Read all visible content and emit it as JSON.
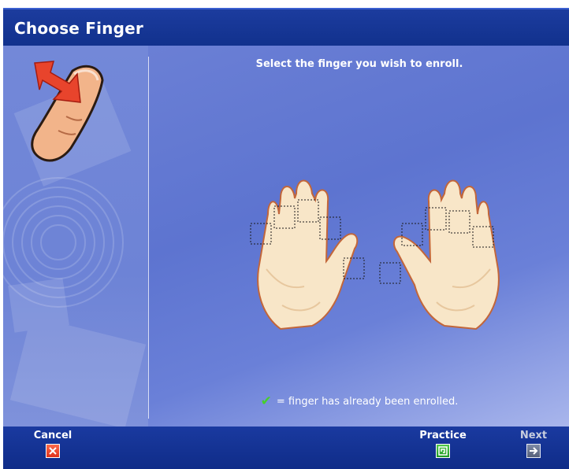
{
  "dialog": {
    "title": "Choose Finger"
  },
  "main": {
    "instruction": "Select the finger you wish to enroll.",
    "legend": {
      "icon": "checkmark-icon",
      "text": "= finger has already been enrolled."
    },
    "hands": {
      "left": [
        "left-little",
        "left-ring",
        "left-middle",
        "left-index",
        "left-thumb"
      ],
      "right": [
        "right-thumb",
        "right-index",
        "right-middle",
        "right-ring",
        "right-little"
      ]
    }
  },
  "footer": {
    "cancel": {
      "label": "Cancel",
      "icon": "close-icon"
    },
    "practice": {
      "label": "Practice",
      "icon": "practice-icon"
    },
    "next": {
      "label": "Next",
      "icon": "arrow-right-icon"
    }
  },
  "colors": {
    "titlebar": "#11318d",
    "content": "#6378d3",
    "skin": "#f8e6c8",
    "skin_outline": "#c2663a",
    "check": "#46d02a",
    "cancel_icon": "#e0321a",
    "practice_icon": "#1f9a26"
  }
}
